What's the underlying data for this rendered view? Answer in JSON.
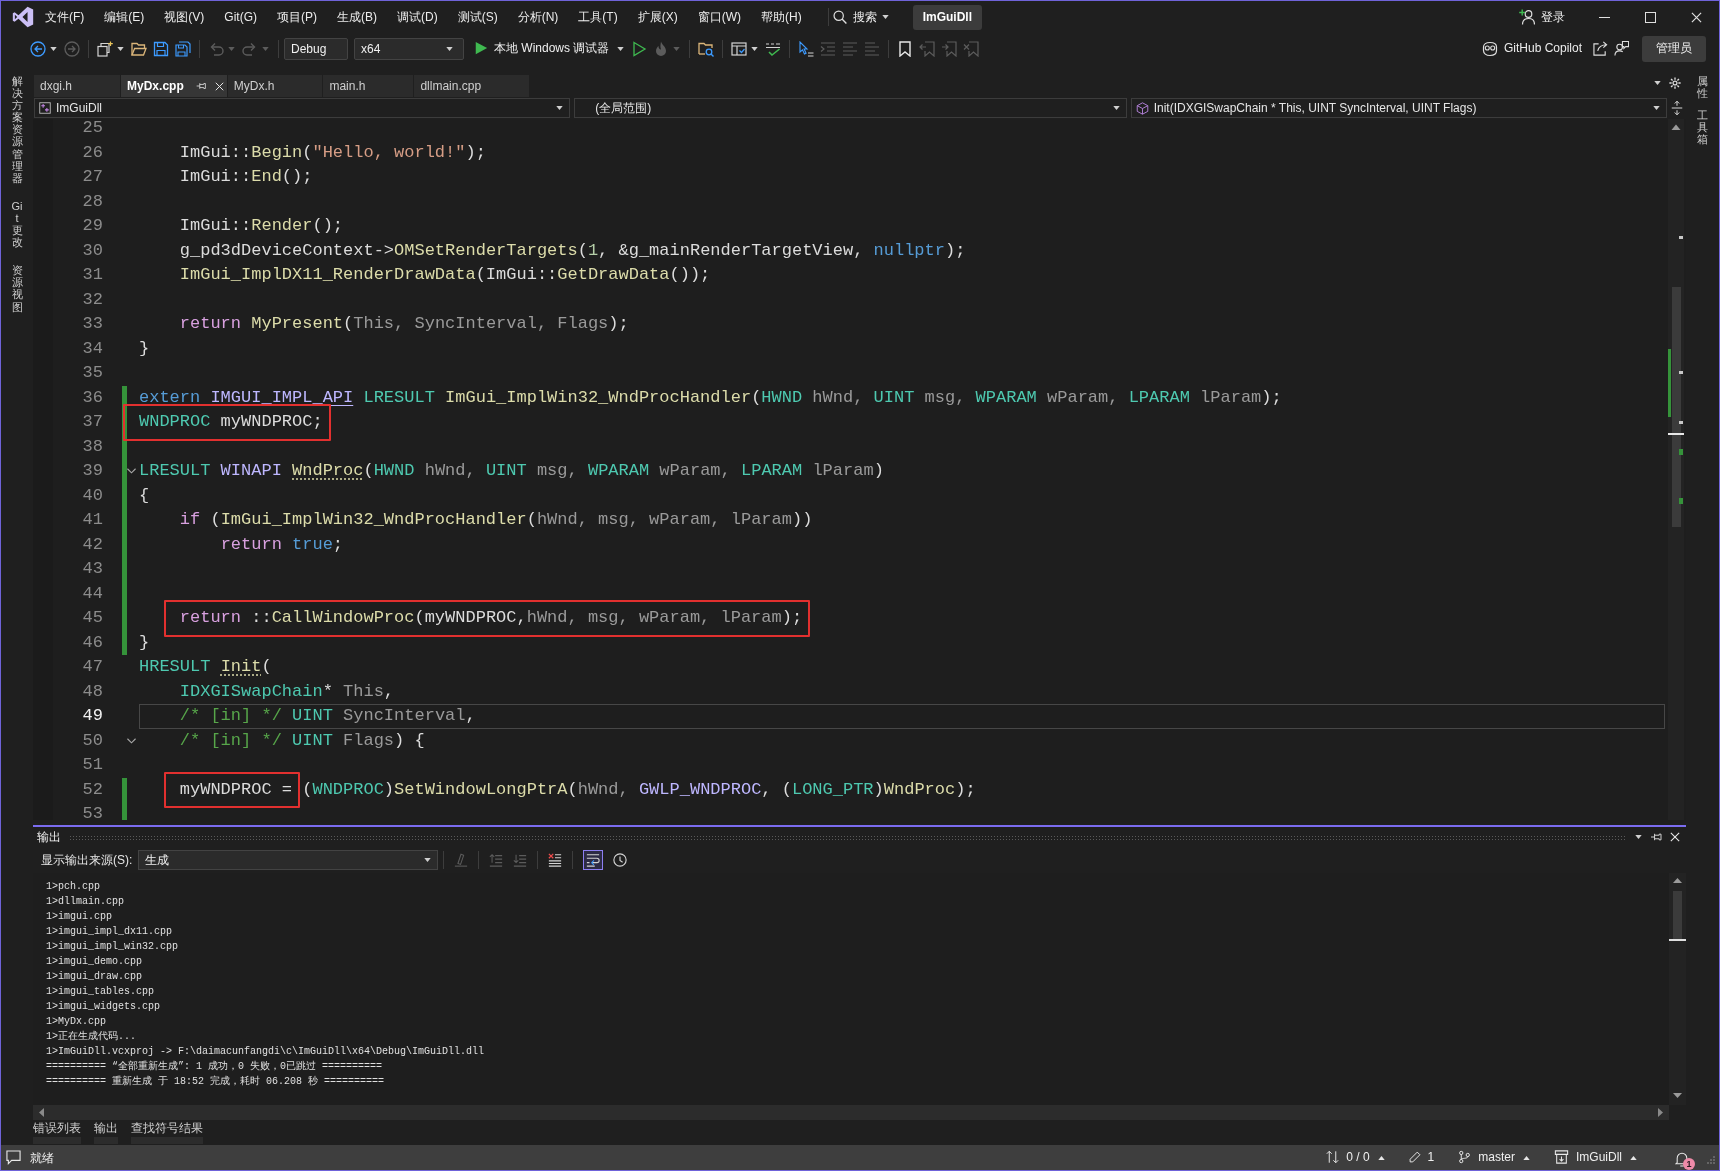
{
  "menu_bar": {
    "menus": [
      "文件(F)",
      "编辑(E)",
      "视图(V)",
      "Git(G)",
      "项目(P)",
      "生成(B)",
      "调试(D)",
      "测试(S)",
      "分析(N)",
      "工具(T)",
      "扩展(X)",
      "窗口(W)",
      "帮助(H)"
    ],
    "search": "搜索",
    "solution": "ImGuiDll",
    "sign_in": "登录"
  },
  "toolbar": {
    "groups": [
      [
        {
          "kind": "back",
          "disabled": false
        },
        {
          "kind": "forward",
          "disabled": true
        }
      ],
      [
        {
          "kind": "new",
          "disabled": false
        },
        {
          "kind": "open",
          "disabled": false
        },
        {
          "kind": "save",
          "disabled": false
        },
        {
          "kind": "saveall",
          "disabled": false
        }
      ],
      [
        {
          "kind": "undo",
          "disabled": true
        },
        {
          "kind": "redo",
          "disabled": true
        }
      ],
      [
        {
          "kind": "combo",
          "value": "Debug",
          "disabled": false
        },
        {
          "kind": "combo",
          "value": "x64",
          "disabled": false
        },
        {
          "kind": "run",
          "label": "本地 Windows 调试器",
          "disabled": false
        },
        {
          "kind": "runoutline",
          "disabled": false
        },
        {
          "kind": "hotreload",
          "disabled": true
        }
      ],
      [
        {
          "kind": "findfiles",
          "disabled": false
        }
      ],
      [
        {
          "kind": "layout",
          "disabled": false
        },
        {
          "kind": "spellcheck",
          "disabled": false
        }
      ],
      [
        {
          "kind": "pointer",
          "disabled": false
        },
        {
          "kind": "indent",
          "disabled": true
        },
        {
          "kind": "comment",
          "disabled": true
        },
        {
          "kind": "uncomment",
          "disabled": true
        }
      ],
      [
        {
          "kind": "bookmark",
          "disabled": false
        },
        {
          "kind": "bookmarkprev",
          "disabled": true
        },
        {
          "kind": "bookmarknext",
          "disabled": true
        },
        {
          "kind": "bookmarkclear",
          "disabled": true
        }
      ]
    ],
    "copilot": "GitHub Copilot",
    "admin": "管理员"
  },
  "left_sidebar": {
    "tabs": [
      "解决方案资源管理器",
      "Git 更改",
      "资源视图"
    ]
  },
  "editor_tabs": [
    {
      "label": "dxgi.h",
      "selected": false
    },
    {
      "label": "MyDx.cpp",
      "selected": true
    },
    {
      "label": "MyDx.h",
      "selected": false
    },
    {
      "label": "main.h",
      "selected": false
    },
    {
      "label": "dllmain.cpp",
      "selected": false
    }
  ],
  "navigation_bar": {
    "project": "ImGuiDll",
    "scope": "(全局范围)",
    "member": "Init(IDXGISwapChain * This, UINT SyncInterval, UINT Flags)"
  },
  "code": {
    "lines": [
      {
        "number": "25",
        "current": false,
        "changed": false,
        "fold": false
      },
      {
        "number": "26",
        "current": false,
        "changed": false,
        "fold": false,
        "segments": [
          {
            "marked": false,
            "tokens": [
              {
                "text": "    ImGui::",
                "kind": "plain"
              },
              {
                "text": "Begin",
                "kind": "function"
              },
              {
                "text": "(",
                "kind": "plain"
              },
              {
                "text": "\"Hello, world!\"",
                "kind": "string"
              },
              {
                "text": ");",
                "kind": "plain"
              }
            ]
          }
        ]
      },
      {
        "number": "27",
        "current": false,
        "changed": false,
        "fold": false,
        "segments": [
          {
            "marked": false,
            "tokens": [
              {
                "text": "    ImGui::",
                "kind": "plain"
              },
              {
                "text": "End",
                "kind": "function"
              },
              {
                "text": "();",
                "kind": "plain"
              }
            ]
          }
        ]
      },
      {
        "number": "28",
        "current": false,
        "changed": false,
        "fold": false
      },
      {
        "number": "29",
        "current": false,
        "changed": false,
        "fold": false,
        "segments": [
          {
            "marked": false,
            "tokens": [
              {
                "text": "    ImGui::",
                "kind": "plain"
              },
              {
                "text": "Render",
                "kind": "function"
              },
              {
                "text": "();",
                "kind": "plain"
              }
            ]
          }
        ]
      },
      {
        "number": "30",
        "current": false,
        "changed": false,
        "fold": false,
        "segments": [
          {
            "marked": false,
            "tokens": [
              {
                "text": "    g_pd3dDeviceContext->",
                "kind": "plain"
              },
              {
                "text": "OMSetRenderTargets",
                "kind": "function"
              },
              {
                "text": "(",
                "kind": "plain"
              },
              {
                "text": "1",
                "kind": "number"
              },
              {
                "text": ", &g_mainRenderTargetView, ",
                "kind": "plain"
              },
              {
                "text": "nullptr",
                "kind": "keyword"
              },
              {
                "text": ");",
                "kind": "plain"
              }
            ]
          }
        ]
      },
      {
        "number": "31",
        "current": false,
        "changed": false,
        "fold": false,
        "segments": [
          {
            "marked": false,
            "tokens": [
              {
                "text": "    ImGui_ImplDX11_RenderDrawData",
                "kind": "function"
              },
              {
                "text": "(ImGui::",
                "kind": "plain"
              },
              {
                "text": "GetDrawData",
                "kind": "function"
              },
              {
                "text": "());",
                "kind": "plain"
              }
            ]
          }
        ]
      },
      {
        "number": "32",
        "current": false,
        "changed": false,
        "fold": false
      },
      {
        "number": "33",
        "current": false,
        "changed": false,
        "fold": false,
        "segments": [
          {
            "marked": false,
            "tokens": [
              {
                "text": "    return ",
                "kind": "control"
              },
              {
                "text": "MyPresent",
                "kind": "function"
              },
              {
                "text": "(",
                "kind": "plain"
              },
              {
                "text": "This, SyncInterval, Flags",
                "kind": "parameter"
              },
              {
                "text": ");",
                "kind": "plain"
              }
            ]
          }
        ]
      },
      {
        "number": "34",
        "current": false,
        "changed": false,
        "fold": false,
        "segments": [
          {
            "marked": false,
            "tokens": [
              {
                "text": "}",
                "kind": "plain"
              }
            ]
          }
        ]
      },
      {
        "number": "35",
        "current": false,
        "changed": false,
        "fold": false
      },
      {
        "number": "36",
        "current": false,
        "changed": true,
        "fold": false,
        "segments": [
          {
            "marked": false,
            "tokens": [
              {
                "text": "extern ",
                "kind": "keyword-underline"
              },
              {
                "text": "IMGUI_IMPL_API",
                "kind": "macro-underline"
              },
              {
                "text": " LRESULT",
                "kind": "type"
              },
              {
                "text": " ImGui_ImplWin32_WndProcHandler",
                "kind": "function"
              },
              {
                "text": "(",
                "kind": "plain"
              },
              {
                "text": "HWND",
                "kind": "type"
              },
              {
                "text": " hWnd, ",
                "kind": "parameter"
              },
              {
                "text": "UINT",
                "kind": "type"
              },
              {
                "text": " msg, ",
                "kind": "parameter"
              },
              {
                "text": "WPARAM",
                "kind": "type"
              },
              {
                "text": " wParam, ",
                "kind": "parameter"
              },
              {
                "text": "LPARAM",
                "kind": "type"
              },
              {
                "text": " lParam",
                "kind": "parameter"
              },
              {
                "text": ");",
                "kind": "plain"
              }
            ]
          }
        ]
      },
      {
        "number": "37",
        "current": false,
        "changed": true,
        "fold": false,
        "segments": [
          {
            "marked": true,
            "tokens": [
              {
                "text": "WNDPROC",
                "kind": "type"
              },
              {
                "text": " myWNDPROC;",
                "kind": "plain"
              }
            ]
          }
        ]
      },
      {
        "number": "38",
        "current": false,
        "changed": true,
        "fold": false
      },
      {
        "number": "39",
        "current": false,
        "changed": true,
        "fold": true,
        "segments": [
          {
            "marked": false,
            "tokens": [
              {
                "text": "LRESULT",
                "kind": "type"
              },
              {
                "text": " WINAPI ",
                "kind": "macro"
              },
              {
                "text": "WndProc",
                "kind": "function-hint"
              },
              {
                "text": "(",
                "kind": "plain"
              },
              {
                "text": "HWND",
                "kind": "type"
              },
              {
                "text": " hWnd, ",
                "kind": "parameter"
              },
              {
                "text": "UINT",
                "kind": "type"
              },
              {
                "text": " msg, ",
                "kind": "parameter"
              },
              {
                "text": "WPARAM",
                "kind": "type"
              },
              {
                "text": " wParam, ",
                "kind": "parameter"
              },
              {
                "text": "LPARAM",
                "kind": "type"
              },
              {
                "text": " lParam",
                "kind": "parameter"
              },
              {
                "text": ")",
                "kind": "plain"
              }
            ]
          }
        ]
      },
      {
        "number": "40",
        "current": false,
        "changed": true,
        "fold": false,
        "segments": [
          {
            "marked": false,
            "tokens": [
              {
                "text": "{",
                "kind": "plain"
              }
            ]
          }
        ]
      },
      {
        "number": "41",
        "current": false,
        "changed": true,
        "fold": false,
        "segments": [
          {
            "marked": false,
            "tokens": [
              {
                "text": "    if",
                "kind": "control"
              },
              {
                "text": " (",
                "kind": "plain"
              },
              {
                "text": "ImGui_ImplWin32_WndProcHandler",
                "kind": "function"
              },
              {
                "text": "(",
                "kind": "plain"
              },
              {
                "text": "hWnd, msg, wParam, lParam",
                "kind": "parameter"
              },
              {
                "text": "))",
                "kind": "plain"
              }
            ]
          }
        ]
      },
      {
        "number": "42",
        "current": false,
        "changed": true,
        "fold": false,
        "segments": [
          {
            "marked": false,
            "tokens": [
              {
                "text": "        return ",
                "kind": "control"
              },
              {
                "text": "true",
                "kind": "keyword"
              },
              {
                "text": ";",
                "kind": "plain"
              }
            ]
          }
        ]
      },
      {
        "number": "43",
        "current": false,
        "changed": true,
        "fold": false
      },
      {
        "number": "44",
        "current": false,
        "changed": true,
        "fold": false
      },
      {
        "number": "45",
        "current": false,
        "changed": true,
        "fold": false,
        "segments": [
          {
            "marked": true,
            "tokens": [
              {
                "text": "    return",
                "kind": "control"
              },
              {
                "text": " ::",
                "kind": "plain"
              },
              {
                "text": "CallWindowProc",
                "kind": "function"
              },
              {
                "text": "(myWNDPROC,",
                "kind": "plain"
              },
              {
                "text": "hWnd, msg, wParam, lParam",
                "kind": "parameter"
              },
              {
                "text": ");",
                "kind": "plain"
              }
            ]
          }
        ]
      },
      {
        "number": "46",
        "current": false,
        "changed": true,
        "fold": false,
        "segments": [
          {
            "marked": false,
            "tokens": [
              {
                "text": "}",
                "kind": "plain"
              }
            ]
          }
        ]
      },
      {
        "number": "47",
        "current": false,
        "changed": false,
        "fold": false,
        "segments": [
          {
            "marked": false,
            "tokens": [
              {
                "text": "HRESULT ",
                "kind": "type"
              },
              {
                "text": "Init",
                "kind": "function-hint"
              },
              {
                "text": "(",
                "kind": "plain"
              }
            ]
          }
        ]
      },
      {
        "number": "48",
        "current": false,
        "changed": false,
        "fold": false,
        "segments": [
          {
            "marked": false,
            "tokens": [
              {
                "text": "    IDXGISwapChain",
                "kind": "type"
              },
              {
                "text": "* ",
                "kind": "plain"
              },
              {
                "text": "This",
                "kind": "parameter"
              },
              {
                "text": ",",
                "kind": "plain"
              }
            ]
          }
        ]
      },
      {
        "number": "49",
        "current": true,
        "changed": false,
        "fold": false,
        "segments": [
          {
            "marked": false,
            "tokens": [
              {
                "text": "    /* [in] */",
                "kind": "comment"
              },
              {
                "text": " UINT ",
                "kind": "type"
              },
              {
                "text": "SyncInterval",
                "kind": "parameter"
              },
              {
                "text": ",",
                "kind": "plain"
              }
            ]
          }
        ]
      },
      {
        "number": "50",
        "current": false,
        "changed": false,
        "fold": true,
        "segments": [
          {
            "marked": false,
            "tokens": [
              {
                "text": "    /* [in] */",
                "kind": "comment"
              },
              {
                "text": " UINT ",
                "kind": "type"
              },
              {
                "text": "Flags",
                "kind": "parameter"
              },
              {
                "text": ") {",
                "kind": "plain"
              }
            ]
          }
        ]
      },
      {
        "number": "51",
        "current": false,
        "changed": false,
        "fold": false
      },
      {
        "number": "52",
        "current": false,
        "changed": true,
        "fold": false,
        "segments": [
          {
            "marked": true,
            "tokens": [
              {
                "text": "    myWNDPROC =",
                "kind": "plain"
              }
            ]
          },
          {
            "marked": false,
            "tokens": [
              {
                "text": " (",
                "kind": "plain"
              },
              {
                "text": "WNDPROC",
                "kind": "type"
              },
              {
                "text": ")",
                "kind": "plain"
              },
              {
                "text": "SetWindowLongPtrA",
                "kind": "function"
              },
              {
                "text": "(",
                "kind": "plain"
              },
              {
                "text": "hWnd,",
                "kind": "parameter"
              },
              {
                "text": " GWLP_WNDPROC",
                "kind": "macro"
              },
              {
                "text": ", (",
                "kind": "plain"
              },
              {
                "text": "LONG_PTR",
                "kind": "type"
              },
              {
                "text": ")",
                "kind": "plain"
              },
              {
                "text": "WndProc",
                "kind": "function"
              },
              {
                "text": ");",
                "kind": "plain"
              }
            ]
          }
        ]
      },
      {
        "number": "53",
        "current": false,
        "changed": true,
        "fold": false
      }
    ]
  },
  "output_panel": {
    "title": "输出",
    "source_label": "显示输出来源(S):",
    "source": "生成",
    "tools": [
      {
        "kind": "find",
        "disabled": true,
        "pressed": false
      },
      {
        "kind": "previous",
        "disabled": true,
        "pressed": false
      },
      {
        "kind": "next",
        "disabled": true,
        "pressed": false
      },
      {
        "kind": "clear",
        "disabled": false,
        "pressed": false
      },
      {
        "kind": "wrap",
        "disabled": false,
        "pressed": true
      },
      {
        "kind": "clock",
        "disabled": false,
        "pressed": false
      }
    ],
    "lines": [
      "1>pch.cpp",
      "1>dllmain.cpp",
      "1>imgui.cpp",
      "1>imgui_impl_dx11.cpp",
      "1>imgui_impl_win32.cpp",
      "1>imgui_demo.cpp",
      "1>imgui_draw.cpp",
      "1>imgui_tables.cpp",
      "1>imgui_widgets.cpp",
      "1>MyDx.cpp",
      "1>正在生成代码...",
      "1>ImGuiDll.vcxproj -> F:\\daimacunfangdi\\c\\ImGuiDll\\x64\\Debug\\ImGuiDll.dll",
      "========== “全部重新生成”: 1 成功，0 失败，0已跳过 ==========",
      "========== 重新生成 于 18:52 完成，耗时 06.208 秒 =========="
    ]
  },
  "bottom_tabs": [
    "错误列表",
    "输出",
    "查找符号结果"
  ],
  "right_sidebar": {
    "tabs": [
      "属性",
      "工具箱"
    ]
  },
  "status_bar": {
    "status": "就绪",
    "sync": "0 / 0",
    "pending_changes": "1",
    "branch": "master",
    "repository": "ImGuiDll",
    "notifications": "1"
  }
}
